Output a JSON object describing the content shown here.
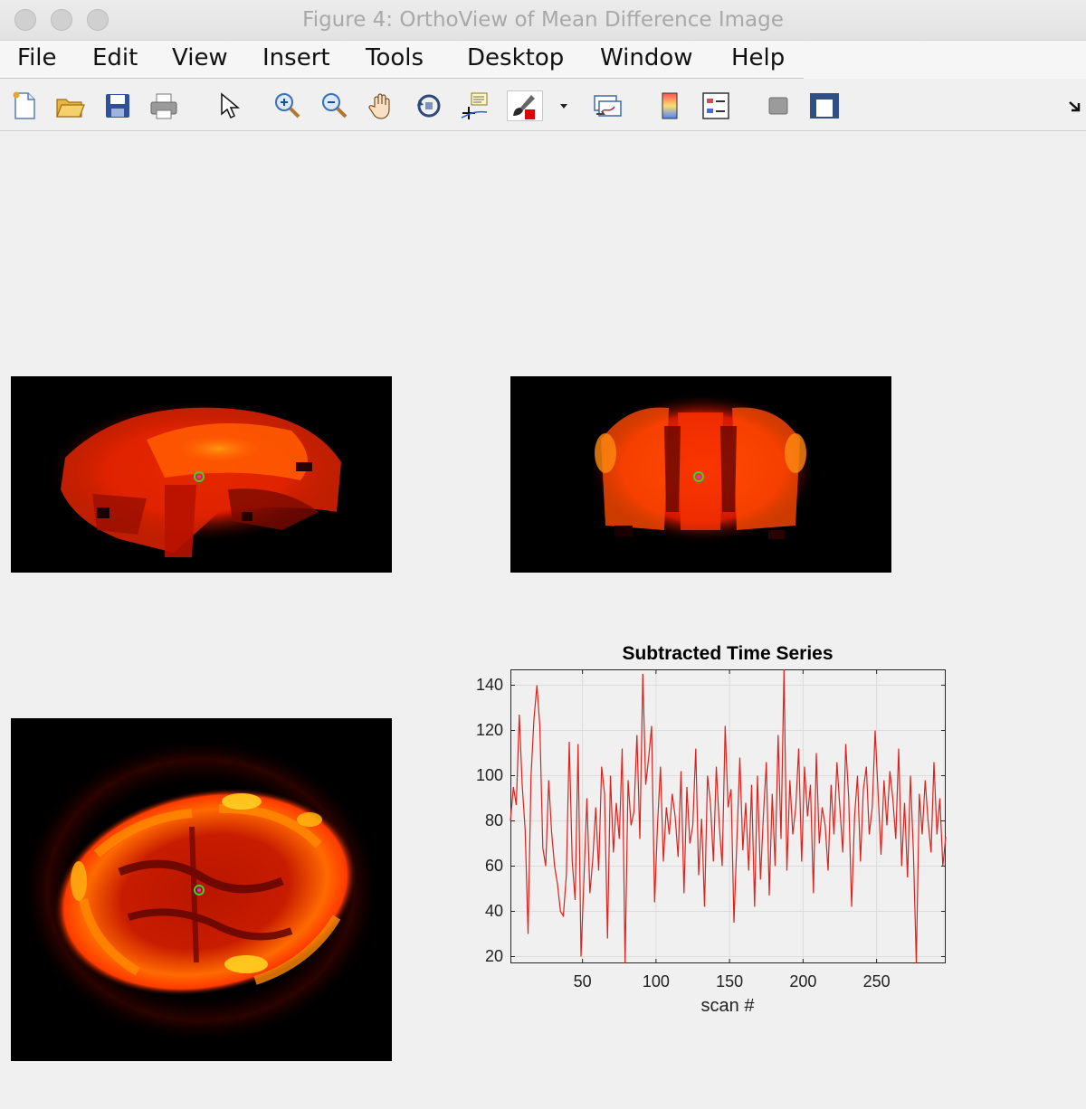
{
  "window": {
    "title": "Figure 4: OrthoView of Mean Difference Image"
  },
  "menu": {
    "items": [
      "File",
      "Edit",
      "View",
      "Insert",
      "Tools",
      "Desktop",
      "Window",
      "Help"
    ]
  },
  "toolbar": {
    "buttons": [
      "new-figure-icon",
      "open-file-icon",
      "save-icon",
      "print-icon",
      "edit-plot-arrow-icon",
      "zoom-in-icon",
      "zoom-out-icon",
      "pan-hand-icon",
      "rotate-3d-icon",
      "data-cursor-icon",
      "brush-icon",
      "brush-dropdown-icon",
      "link-plot-icon",
      "colorbar-icon",
      "legend-icon",
      "hide-plot-tools-icon",
      "show-plot-tools-icon",
      "dock-arrow-icon"
    ]
  },
  "colors": {
    "plot_line": "#e0201a",
    "crosshair_green": "#3bd13b",
    "crosshair_magenta": "#d633d6"
  },
  "chart_data": {
    "type": "line",
    "title": "Subtracted Time Series",
    "xlabel": "scan #",
    "ylabel": "",
    "xlim": [
      1,
      297
    ],
    "ylim": [
      17,
      147
    ],
    "xticks": [
      50,
      100,
      150,
      200,
      250
    ],
    "yticks": [
      20,
      40,
      60,
      80,
      100,
      120,
      140
    ],
    "grid": true,
    "x": [
      1,
      3,
      5,
      7,
      9,
      11,
      13,
      15,
      17,
      19,
      21,
      23,
      25,
      27,
      29,
      31,
      33,
      35,
      37,
      39,
      41,
      43,
      45,
      47,
      49,
      51,
      53,
      55,
      57,
      59,
      61,
      63,
      65,
      67,
      69,
      71,
      73,
      75,
      77,
      79,
      81,
      83,
      85,
      87,
      89,
      91,
      93,
      95,
      97,
      99,
      101,
      103,
      105,
      107,
      109,
      111,
      113,
      115,
      117,
      119,
      121,
      123,
      125,
      127,
      129,
      131,
      133,
      135,
      137,
      139,
      141,
      143,
      145,
      147,
      149,
      151,
      153,
      155,
      157,
      159,
      161,
      163,
      165,
      167,
      169,
      171,
      173,
      175,
      177,
      179,
      181,
      183,
      185,
      187,
      189,
      191,
      193,
      195,
      197,
      199,
      201,
      203,
      205,
      207,
      209,
      211,
      213,
      215,
      217,
      219,
      221,
      223,
      225,
      227,
      229,
      231,
      233,
      235,
      237,
      239,
      241,
      243,
      245,
      247,
      249,
      251,
      253,
      255,
      257,
      259,
      261,
      263,
      265,
      267,
      269,
      271,
      273,
      275,
      277,
      279,
      281,
      283,
      285,
      287,
      289,
      291,
      293,
      295,
      297
    ],
    "series": [
      {
        "values": [
          80,
          95,
          87,
          127,
          96,
          76,
          30,
          100,
          125,
          140,
          122,
          68,
          60,
          98,
          75,
          60,
          52,
          40,
          38,
          56,
          115,
          62,
          45,
          114,
          20,
          55,
          90,
          48,
          63,
          86,
          58,
          104,
          92,
          28,
          100,
          66,
          88,
          72,
          112,
          17,
          98,
          78,
          84,
          118,
          72,
          145,
          96,
          108,
          122,
          44,
          78,
          104,
          62,
          86,
          74,
          92,
          82,
          64,
          102,
          48,
          95,
          70,
          78,
          112,
          56,
          81,
          42,
          100,
          88,
          62,
          104,
          78,
          60,
          122,
          86,
          94,
          35,
          72,
          108,
          67,
          88,
          58,
          96,
          42,
          100,
          54,
          82,
          106,
          47,
          92,
          60,
          118,
          72,
          147,
          58,
          98,
          74,
          86,
          112,
          62,
          104,
          82,
          96,
          48,
          110,
          70,
          86,
          78,
          58,
          96,
          74,
          106,
          86,
          66,
          114,
          90,
          42,
          82,
          100,
          62,
          94,
          104,
          74,
          86,
          120,
          92,
          65,
          98,
          78,
          102,
          90,
          72,
          112,
          60,
          88,
          55,
          100,
          66,
          17,
          92,
          74,
          98,
          80,
          66,
          106,
          74,
          90,
          60,
          73
        ]
      }
    ]
  }
}
